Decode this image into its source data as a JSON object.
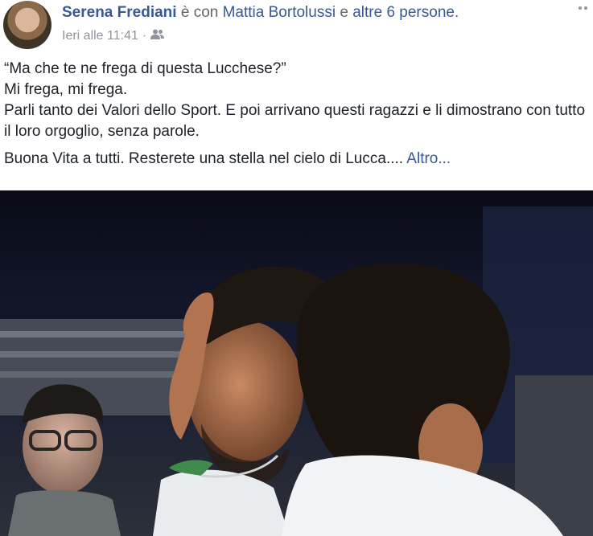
{
  "header": {
    "author": "Serena Frediani",
    "with_word": "è con",
    "tagged_person": "Mattia Bortolussi",
    "and_word": "e",
    "others_link": "altre 6 persone",
    "period": ".",
    "timestamp": "Ieri alle 11:41",
    "separator": "·",
    "audience_icon": "friends-icon"
  },
  "post": {
    "line1": "“Ma che te ne frega di questa Lucchese?”",
    "line2": "Mi frega, mi frega.",
    "line3": "Parli tanto dei Valori dello Sport. E poi arrivano questi ragazzi e li dimostrano con tutto il loro orgoglio, senza parole.",
    "line4": "Buona Vita a tutti. Resterete una stella nel cielo di Lucca....",
    "see_more": "Altro..."
  },
  "colors": {
    "link": "#385898",
    "text": "#1d2129",
    "meta": "#90949c"
  }
}
